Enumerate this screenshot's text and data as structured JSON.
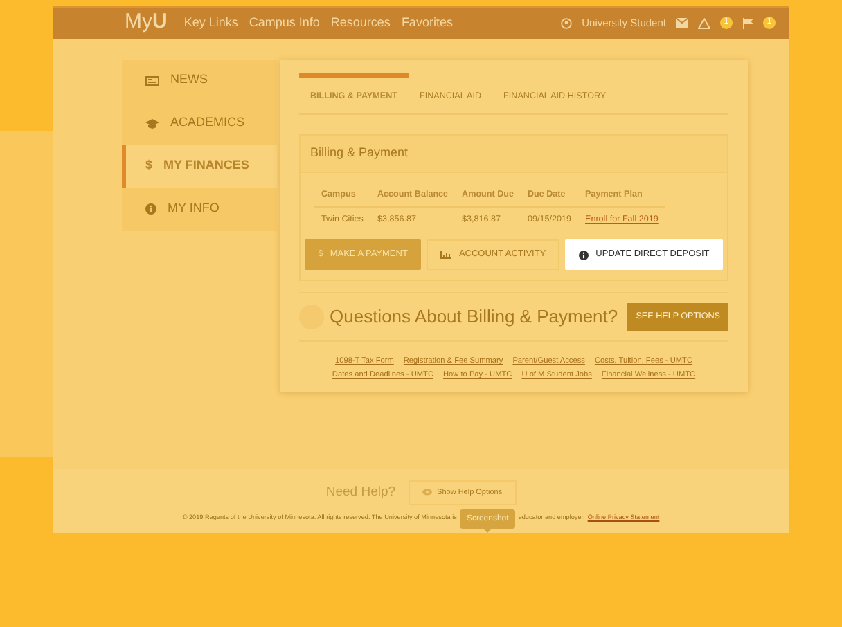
{
  "navbar": {
    "logo": "My**U**",
    "links": [
      "Key Links",
      "Campus Info",
      "Resources",
      "Favorites"
    ],
    "user": "University Student",
    "alert_count": "1",
    "flag_count": "1"
  },
  "sidebar": {
    "items": [
      {
        "label": "NEWS",
        "kind": "news",
        "selected": false
      },
      {
        "label": "ACADEMICS",
        "kind": "academics",
        "selected": false
      },
      {
        "label": "MY FINANCES",
        "kind": "glyph",
        "glyph": "$",
        "selected": true
      },
      {
        "label": "MY INFO",
        "kind": "info",
        "selected": false
      }
    ]
  },
  "tabs": [
    {
      "label": "BILLING & PAYMENT",
      "selected": true
    },
    {
      "label": "FINANCIAL AID",
      "selected": false
    },
    {
      "label": "FINANCIAL AID HISTORY",
      "selected": false
    }
  ],
  "panel": {
    "title": "Billing & Payment",
    "table": {
      "columns": [
        "Campus",
        "Account Balance",
        "Amount Due",
        "Due Date",
        "Payment Plan"
      ],
      "rows": [
        [
          "Twin Cities",
          "$3,856.87",
          "$3,816.87",
          "09/15/2019",
          "Enroll for Fall 2019"
        ]
      ]
    },
    "buttons": [
      {
        "label": "MAKE A PAYMENT",
        "kind": "filled",
        "glyph": "$",
        "highlighted": false
      },
      {
        "label": "ACCOUNT ACTIVITY",
        "kind": "chart",
        "highlighted": false
      },
      {
        "label": "UPDATE DIRECT DEPOSIT",
        "kind": "info",
        "highlighted": true
      }
    ]
  },
  "help": {
    "heading": "Questions About Billing & Payment?",
    "button": "SEE HELP OPTIONS",
    "links": [
      [
        "1098-T Tax Form",
        "Registration & Fee Summary",
        "Parent/Guest Access",
        "Costs, Tuition, Fees - UMTC"
      ],
      [
        "Dates and Deadlines - UMTC",
        "How to Pay - UMTC",
        "U of M Student Jobs",
        "Financial Wellness - UMTC"
      ]
    ]
  },
  "footer": {
    "need_help": "Need Help?",
    "show_help": "Show Help Options",
    "copyright": "© 2019 Regents of the University of Minnesota. All rights reserved. The University of Minnesota is",
    "copyright_end": "educator and employer.",
    "privacy_link": "Online Privacy Statement",
    "tooltip": "Screenshot"
  }
}
